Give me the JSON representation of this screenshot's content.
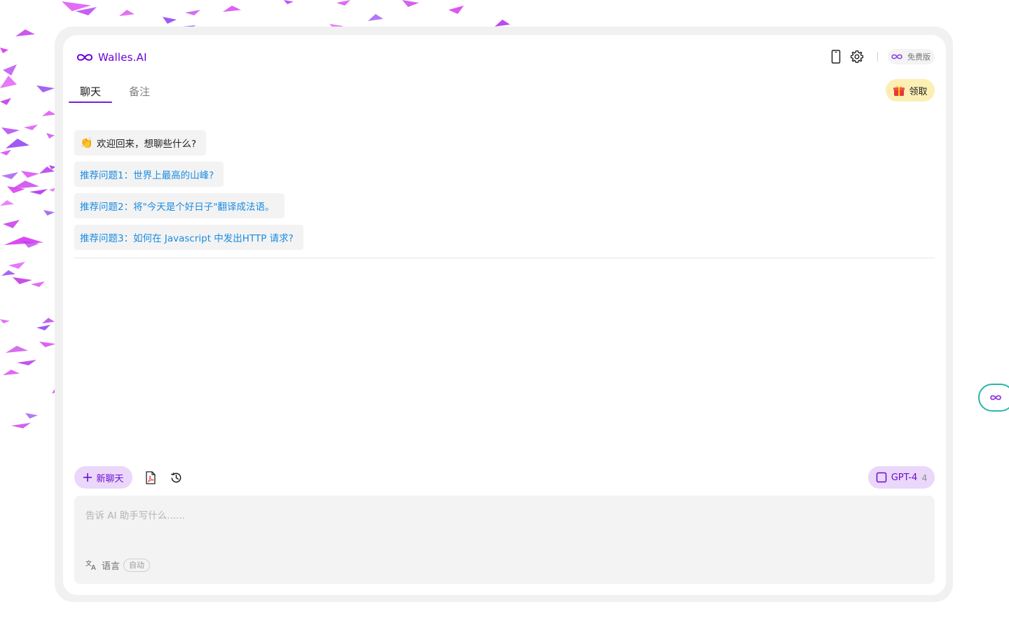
{
  "brand": {
    "name": "Walles.AI",
    "accent": "#6a00d8",
    "icon": "infinity-icon"
  },
  "header": {
    "icons": [
      "phone-icon",
      "gear-icon"
    ],
    "plan_label": "免费版",
    "reward_label": "领取",
    "reward_icon": "gift-icon"
  },
  "tabs": [
    {
      "label": "聊天",
      "active": true
    },
    {
      "label": "备注",
      "active": false
    }
  ],
  "chat": {
    "greeting": "欢迎回来，想聊些什么?",
    "greeting_icon": "clapping-hands-icon",
    "suggestions": [
      "推荐问题1：世界上最高的山峰?",
      "推荐问题2：将\"今天是个好日子\"翻译成法语。",
      "推荐问题3：如何在 Javascript 中发出HTTP 请求?"
    ]
  },
  "toolbar": {
    "new_chat_label": "新聊天",
    "pdf_icon": "pdf-icon",
    "history_icon": "history-icon",
    "model_label": "GPT-4",
    "model_count": "4"
  },
  "composer": {
    "placeholder": "告诉 AI 助手写什么......",
    "value": "",
    "language_label": "语言",
    "language_value": "自动"
  },
  "colors": {
    "accent_purple": "#6a0fd0",
    "chip_purple": "#ead7f9",
    "suggestion_blue": "#1a8ce0",
    "reward_yellow": "#fcefb4",
    "float_border": "#2bb7a4",
    "decor_magenta": "#d83cf0"
  }
}
